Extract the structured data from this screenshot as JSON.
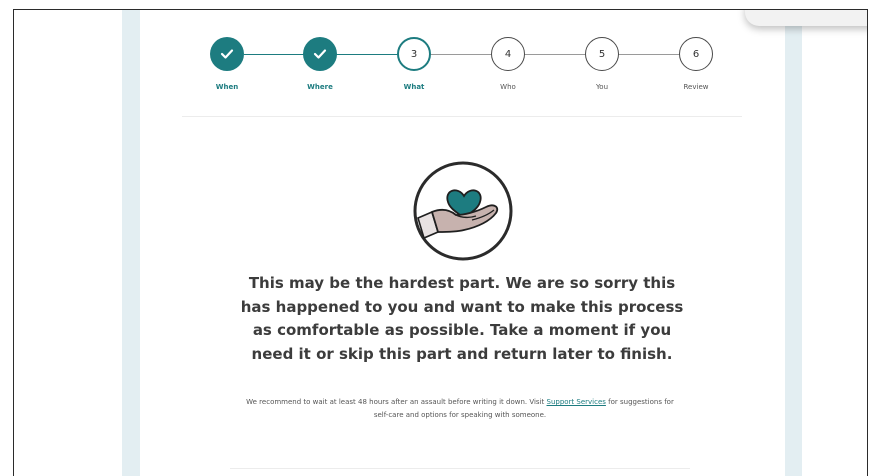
{
  "steps": [
    {
      "label": "When",
      "number": "1",
      "status": "done"
    },
    {
      "label": "Where",
      "number": "2",
      "status": "done"
    },
    {
      "label": "What",
      "number": "3",
      "status": "current"
    },
    {
      "label": "Who",
      "number": "4",
      "status": "todo"
    },
    {
      "label": "You",
      "number": "5",
      "status": "todo"
    },
    {
      "label": "Review",
      "number": "6",
      "status": "todo"
    }
  ],
  "illustration": {
    "icon": "hand-holding-heart-icon"
  },
  "headline": "This may be the hardest part. We are so sorry this has happened to you and want to make this process as comfortable as possible. Take a moment if you need it or skip this part and return later to finish.",
  "note": {
    "before_link": "We recommend to wait at least 48 hours after an assault before writing it down. Visit",
    "link_text": "Support Services",
    "after_link": "for suggestions for self-care and options for speaking with someone."
  },
  "colors": {
    "accent": "#1d7c80",
    "backdrop": "#e3eef2",
    "text": "#3c3c3c"
  }
}
